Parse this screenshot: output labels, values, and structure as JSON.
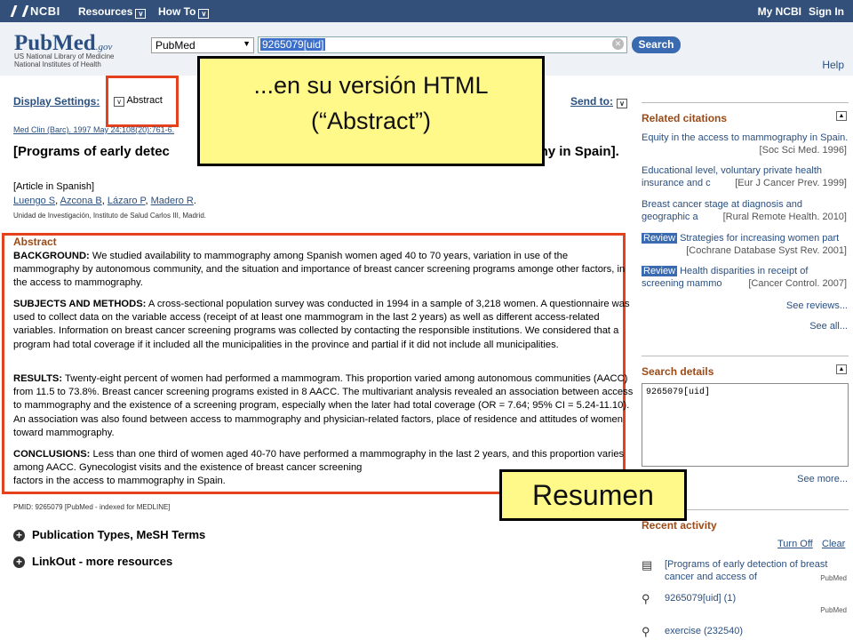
{
  "topbar": {
    "logo": "NCBI",
    "resources": "Resources",
    "howto": "How To",
    "myncbi": "My NCBI",
    "signin": "Sign In"
  },
  "header": {
    "logo_pub": "Pub",
    "logo_med": "Med",
    "logo_gov": ".gov",
    "sub1": "US National Library of Medicine",
    "sub2": "National Institutes of Health",
    "db": "PubMed",
    "query": "9265079[uid]",
    "search_btn": "Search",
    "help": "Help"
  },
  "display": {
    "settings": "Display Settings:",
    "value": "Abstract",
    "send": "Send to:"
  },
  "article": {
    "cite": "Med Clin (Barc). 1997 May 24;108(20):761-6.",
    "title": "[Programs of early detec",
    "title_end": "aphy in Spain].",
    "lang": "[Article in Spanish]",
    "authors": [
      "Luengo S",
      "Azcona B",
      "Lázaro P",
      "Madero R"
    ],
    "affil": "Unidad de Investigación, Instituto de Salud Carlos III, Madrid.",
    "abstract_head": "Abstract",
    "p1_label": "BACKGROUND:",
    "p1": " We studied availability to mammography among Spanish women aged 40 to 70 years, variation in use of the mammography by autonomous community, and the situation and importance of breast cancer screening programs amonge other factors, in the access to mammography.",
    "p2_label": "SUBJECTS AND METHODS:",
    "p2": " A cross-sectional population survey was conducted in 1994 in a sample of 3,218 women. A questionnaire was used to collect data on the variable access (receipt of at least one mammogram in the last 2 years) as well as different access-related variables. Information on breast cancer screening programs was collected by contacting the responsible institutions. We considered that a program had total coverage if it included all the municipalities in the province and partial if it did not include all municipalities.",
    "p3_label": "RESULTS:",
    "p3": " Twenty-eight percent of women had performed a mammogram. This proportion varied among autonomous communities (AACC) from 11.5 to 73.8%. Breast cancer screening programs existed in 8 AACC. The multivariant analysis revealed an association between access to mammography and the existence of a screening program, especially when the later had total coverage (OR = 7.64; 95% CI = 5.24-11.10). An association was also found between access to mammography and physician-related factors, place of residence and attitudes of women toward mammography.",
    "p4_label": "CONCLUSIONS:",
    "p4": " Less than one third of women aged 40-70 have performed a mammography in the last 2 years, and this proportion varies among AACC. Gynecologist visits and the existence of breast cancer screening",
    "p4_end": "factors in the access to mammography in Spain.",
    "pmid": "PMID: 9265079 [PubMed - indexed for MEDLINE]",
    "exp1": "Publication Types, MeSH Terms",
    "exp2": "LinkOut - more resources"
  },
  "sidebar": {
    "related_title": "Related citations",
    "related": [
      {
        "t": "Equity in the access to mammography in Spain.",
        "s": "[Soc Sci Med. 1996]"
      },
      {
        "t": "Educational level, voluntary private health insurance and c",
        "s": "[Eur J Cancer Prev. 1999]"
      },
      {
        "t": "Breast cancer stage at diagnosis and geographic a",
        "s": "[Rural Remote Health. 2010]"
      },
      {
        "badge": "Review",
        "t": "Strategies for increasing women part",
        "s": "[Cochrane Database Syst Rev. 2001]"
      },
      {
        "badge": "Review",
        "t": "Health disparities in receipt of screening mammo",
        "s": "[Cancer Control. 2007]"
      }
    ],
    "see_reviews": "See reviews...",
    "see_all": "See all...",
    "search_details_title": "Search details",
    "search_details_text": "9265079[uid]",
    "see_more": "See more...",
    "recent_title": "Recent activity",
    "turn_off": "Turn Off",
    "clear": "Clear",
    "recent": [
      {
        "t": "[Programs of early detection of breast cancer and access of",
        "src": "PubMed"
      },
      {
        "t": "9265079[uid] (1)",
        "src": "PubMed"
      },
      {
        "t": "exercise (232540)",
        "src": ""
      }
    ]
  },
  "callouts": {
    "c1_line1": "...en su versión HTML",
    "c1_line2": "(“Abstract”)",
    "c2": "Resumen"
  }
}
